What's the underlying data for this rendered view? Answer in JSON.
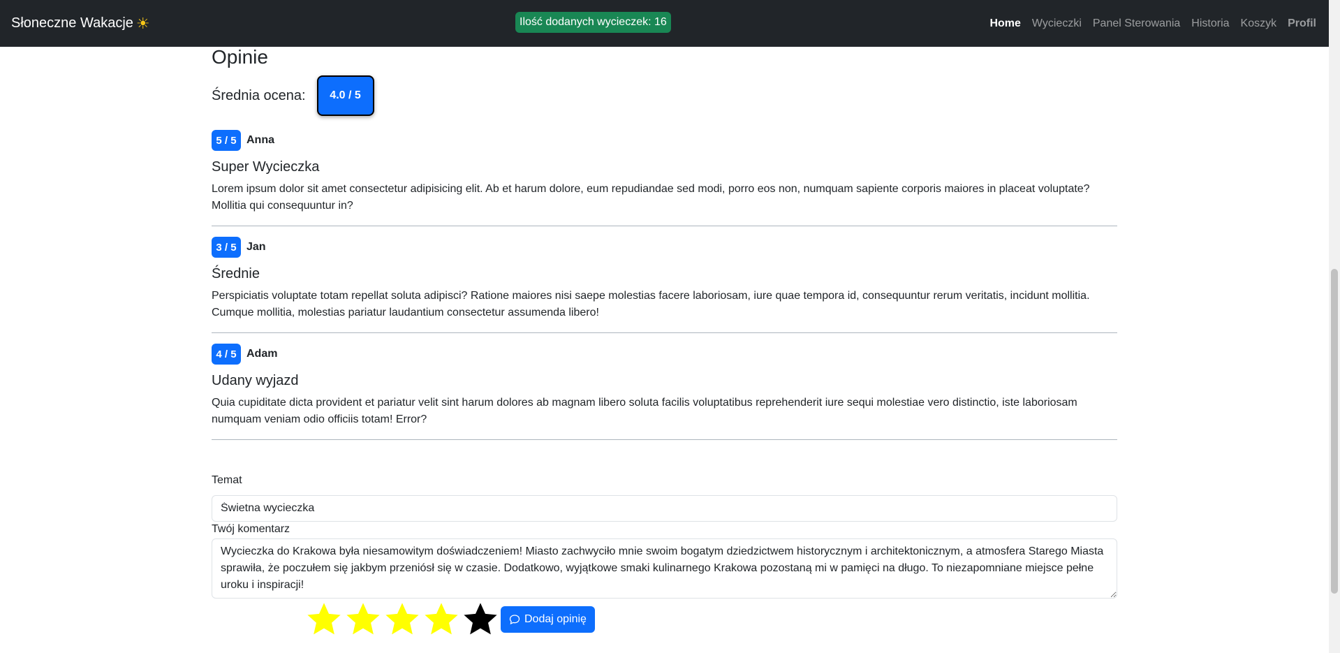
{
  "navbar": {
    "brand": "Słoneczne Wakacje",
    "brand_icon": "sun-icon",
    "count_badge": "Ilość dodanych wycieczek: 16",
    "links": [
      "Home",
      "Wycieczki",
      "Panel Sterowania",
      "Historia",
      "Koszyk",
      "Profil"
    ],
    "active": "Home"
  },
  "reviews_section": {
    "title": "Opinie",
    "average_label": "Średnia ocena:",
    "average_value": "4.0 / 5",
    "reviews": [
      {
        "rating": "5 / 5",
        "author": "Anna",
        "title": "Super Wycieczka",
        "text": "Lorem ipsum dolor sit amet consectetur adipisicing elit. Ab et harum dolore, eum repudiandae sed modi, porro eos non, numquam sapiente corporis maiores in placeat voluptate? Mollitia qui consequuntur in?"
      },
      {
        "rating": "3 / 5",
        "author": "Jan",
        "title": "Średnie",
        "text": "Perspiciatis voluptate totam repellat soluta adipisci? Ratione maiores nisi saepe molestias facere laboriosam, iure quae tempora id, consequuntur rerum veritatis, incidunt mollitia. Cumque mollitia, molestias pariatur laudantium consectetur assumenda libero!"
      },
      {
        "rating": "4 / 5",
        "author": "Adam",
        "title": "Udany wyjazd",
        "text": "Quia cupiditate dicta provident et pariatur velit sint harum dolores ab magnam libero soluta facilis voluptatibus reprehenderit iure sequi molestiae vero distinctio, iste laboriosam numquam veniam odio officiis totam! Error?"
      }
    ]
  },
  "form": {
    "topic_label": "Temat",
    "topic_value": "Świetna wycieczka",
    "comment_label": "Twój komentarz",
    "comment_value": "Wycieczka do Krakowa była niesamowitym doświadczeniem! Miasto zachwyciło mnie swoim bogatym dziedzictwem historycznym i architektonicznym, a atmosfera Starego Miasta sprawiła, że poczułem się jakbym przeniósł się w czasie. Dodatkowo, wyjątkowe smaki kulinarnego Krakowa pozostaną mi w pamięci na długo. To niezapomniane miejsce pełne uroku i inspiracji!",
    "rating_selected": 4,
    "rating_max": 5,
    "star_active_color": "#ffff00",
    "star_inactive_color": "#000000",
    "submit_label": "Dodaj opinię",
    "submit_icon": "chat-icon"
  }
}
